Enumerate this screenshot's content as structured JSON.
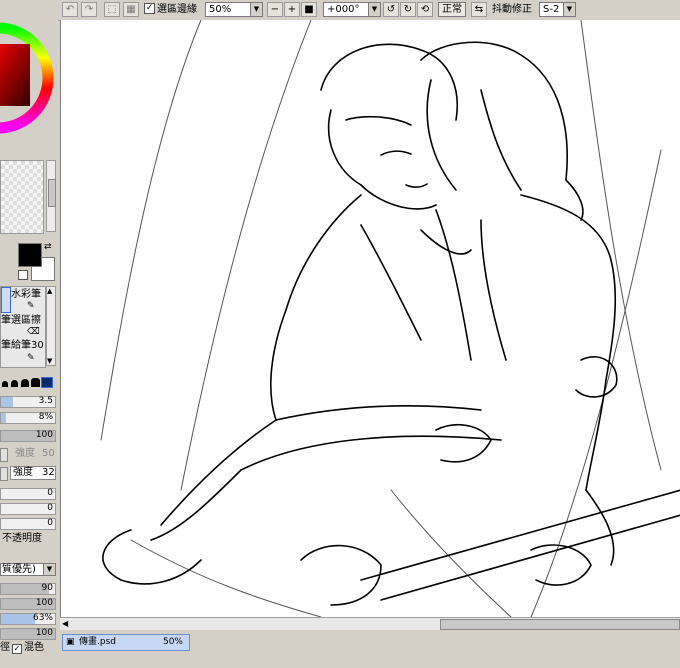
{
  "toolbar": {
    "selection_outline_label": "選區邊緣",
    "selection_outline_checked": true,
    "zoom_value": "50%",
    "rotation_value": "+000°",
    "blend_mode": "正常",
    "stabilizer_label": "抖動修正",
    "stabilizer_value": "S-2",
    "dropdown_glyph": "▼",
    "zoom_out_glyph": "−",
    "zoom_in_glyph": "+",
    "zoom_reset_glyph": "■"
  },
  "brush_panel": {
    "watercolor_label": "水彩筆",
    "pen_partial": "筆",
    "select_pen_label": "選區擦",
    "pen_partial_2": "筆",
    "brush_size_label": "給筆30"
  },
  "tool_settings": {
    "size_value": "3.5",
    "min_size_value": "8%",
    "density_value": "100",
    "strength_label": "強度",
    "strength_value": "50",
    "strength2_label": "強度",
    "strength2_value": "32",
    "blend_value": "0",
    "dilution_value": "0",
    "persistence_value": "0",
    "keep_opacity_label": "不透明度",
    "quality_label": "質優先)",
    "value_90": "90",
    "value_100a": "100",
    "value_63": "63%",
    "value_100b": "100",
    "trailing_char": "徑",
    "mix_label": "混色",
    "mix_checked": true
  },
  "file_tab": {
    "name": "傳畫.psd",
    "zoom": "50%"
  },
  "colors": {
    "chrome": "#d4d0c8",
    "canvas": "#ffffff",
    "tab_fill": "#c6d8f4",
    "slider_fill": "#a9c4e8",
    "primary_color": "#000000",
    "secondary_color": "#ffffff"
  }
}
